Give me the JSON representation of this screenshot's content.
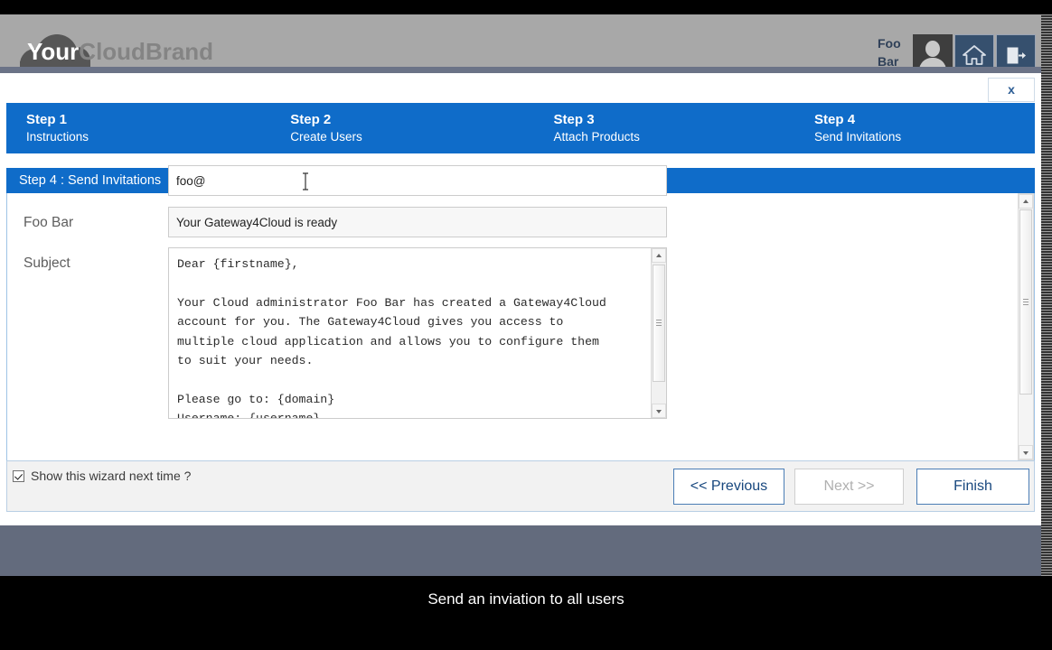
{
  "header": {
    "logo_prefix": "Your",
    "logo_suffix": "CloudBrand",
    "user_line1": "Foo",
    "user_line2": "Bar",
    "avatar_icon": "user-avatar-icon",
    "home_icon": "home-icon",
    "logout_icon": "logout-icon"
  },
  "wizard": {
    "close_label": "x",
    "steps": [
      {
        "title": "Step 1",
        "subtitle": "Instructions"
      },
      {
        "title": "Step 2",
        "subtitle": "Create Users"
      },
      {
        "title": "Step 3",
        "subtitle": "Attach Products"
      },
      {
        "title": "Step 4",
        "subtitle": "Send Invitations"
      }
    ],
    "section_title": "Step 4 : Send Invitations",
    "form": {
      "email_label": "Foo Bar",
      "email_value": "foo@",
      "email_placeholder": "",
      "subject_label": "Subject",
      "subject_value": "Your Gateway4Cloud is ready",
      "subject_placeholder": "",
      "body_value": "Dear {firstname},\n\nYour Cloud administrator Foo Bar has created a Gateway4Cloud\naccount for you. The Gateway4Cloud gives you access to\nmultiple cloud application and allows you to configure them\nto suit your needs.\n\nPlease go to: {domain}\nUsername: {username}\nPassword: {password}"
    },
    "footer": {
      "checkbox_label": "Show this wizard next time ?",
      "checkbox_checked": true,
      "previous_label": "<< Previous",
      "next_label": "Next >>",
      "next_disabled": true,
      "finish_label": "Finish"
    }
  },
  "caption": "Send an inviation to all users",
  "colors": {
    "accent_blue": "#0f6cc9",
    "header_gray": "#a8a8a8",
    "slate": "#636b7d",
    "button_text": "#17477e"
  }
}
